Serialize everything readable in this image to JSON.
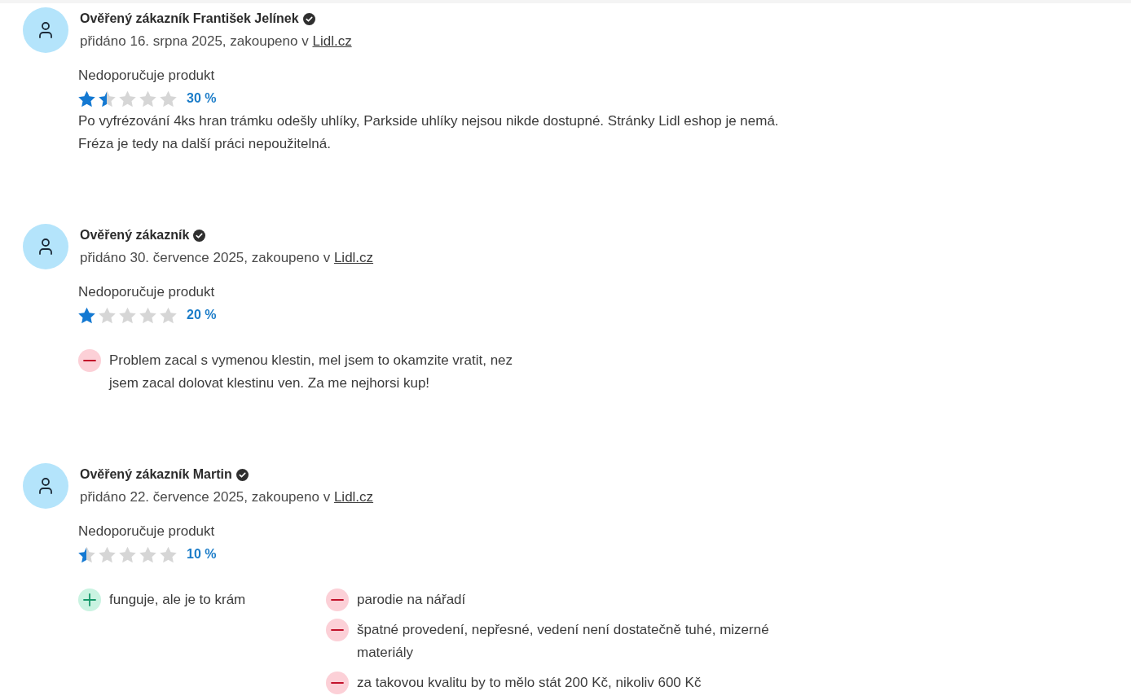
{
  "reviews": [
    {
      "author": "Ověřený zákazník František Jelínek",
      "verified": true,
      "date_line": "přidáno 16. srpna 2025, zakoupeno v",
      "shop": "Lidl.cz",
      "recommendation": "Nedoporučuje produkt",
      "stars": 1.5,
      "rating": "30 %",
      "text": "Po vyfrézování 4ks hran trámku odešly uhlíky, Parkside uhlíky nejsou nikde dostupné. Stránky Lidl eshop je nemá.\nFréza je tedy na další práci nepoužitelná."
    },
    {
      "author": "Ověřený zákazník",
      "verified": true,
      "date_line": "přidáno 30. července 2025, zakoupeno v",
      "shop": "Lidl.cz",
      "recommendation": "Nedoporučuje produkt",
      "stars": 1,
      "rating": "20 %",
      "cons": [
        "Problem zacal s vymenou klestin, mel jsem to okamzite vratit, nez jsem zacal dolovat klestinu ven. Za me nejhorsi kup!"
      ]
    },
    {
      "author": "Ověřený zákazník Martin",
      "verified": true,
      "date_line": "přidáno 22. července 2025, zakoupeno v",
      "shop": "Lidl.cz",
      "recommendation": "Nedoporučuje produkt",
      "stars": 0.5,
      "rating": "10 %",
      "pros": [
        "funguje, ale je to krám"
      ],
      "cons": [
        "parodie na nářadí",
        "špatné provedení, nepřesné, vedení není dostatečně tuhé, mizerné materiály",
        "za takovou kvalitu by to mělo stát 200 Kč, nikoliv 600 Kč"
      ]
    }
  ]
}
